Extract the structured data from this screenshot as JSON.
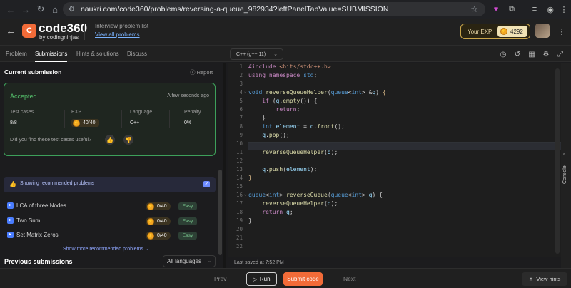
{
  "browser": {
    "url": "naukri.com/code360/problems/reversing-a-queue_982934?leftPanelTabValue=SUBMISSION"
  },
  "header": {
    "logo_text": "code360",
    "logo_sub": "by codingninjas",
    "list_label": "Interview problem list",
    "view_all": "View all problems",
    "exp_label": "Your EXP",
    "exp_value": "4292"
  },
  "tabs": [
    "Problem",
    "Submissions",
    "Hints & solutions",
    "Discuss"
  ],
  "language_select": "C++ (g++ 11)",
  "submission": {
    "title": "Current submission",
    "report": "Report",
    "status": "Accepted",
    "time": "A few seconds ago",
    "labels": {
      "tests": "Test cases",
      "exp": "EXP",
      "lang": "Language",
      "penalty": "Penalty"
    },
    "values": {
      "tests": "8/8",
      "exp": "40/40",
      "lang": "C++",
      "penalty": "0%"
    },
    "useful_q": "Did you find these test cases useful?"
  },
  "recommended": {
    "bar_label": "Showing recommended problems",
    "items": [
      {
        "name": "LCA of three Nodes",
        "exp": "0/40",
        "difficulty": "Easy"
      },
      {
        "name": "Two Sum",
        "exp": "0/40",
        "difficulty": "Easy"
      },
      {
        "name": "Set Matrix Zeros",
        "exp": "0/40",
        "difficulty": "Easy"
      }
    ],
    "show_more": "Show more recommended problems"
  },
  "previous": {
    "title": "Previous submissions",
    "filter": "All languages"
  },
  "editor": {
    "line_numbers": [
      "1",
      "2",
      "3",
      "4",
      "5",
      "6",
      "7",
      "8",
      "9",
      "10",
      "11",
      "12",
      "13",
      "14",
      "15",
      "16",
      "17",
      "18",
      "19",
      "20",
      "21",
      "22"
    ],
    "last_saved": "Last saved at 7:52 PM"
  },
  "console_label": "Console",
  "bottom": {
    "prev": "Prev",
    "run": "Run",
    "submit": "Submit code",
    "next": "Next",
    "hints": "View hints"
  },
  "colors": {
    "accent": "#f26b38",
    "accepted": "#55c26c"
  }
}
